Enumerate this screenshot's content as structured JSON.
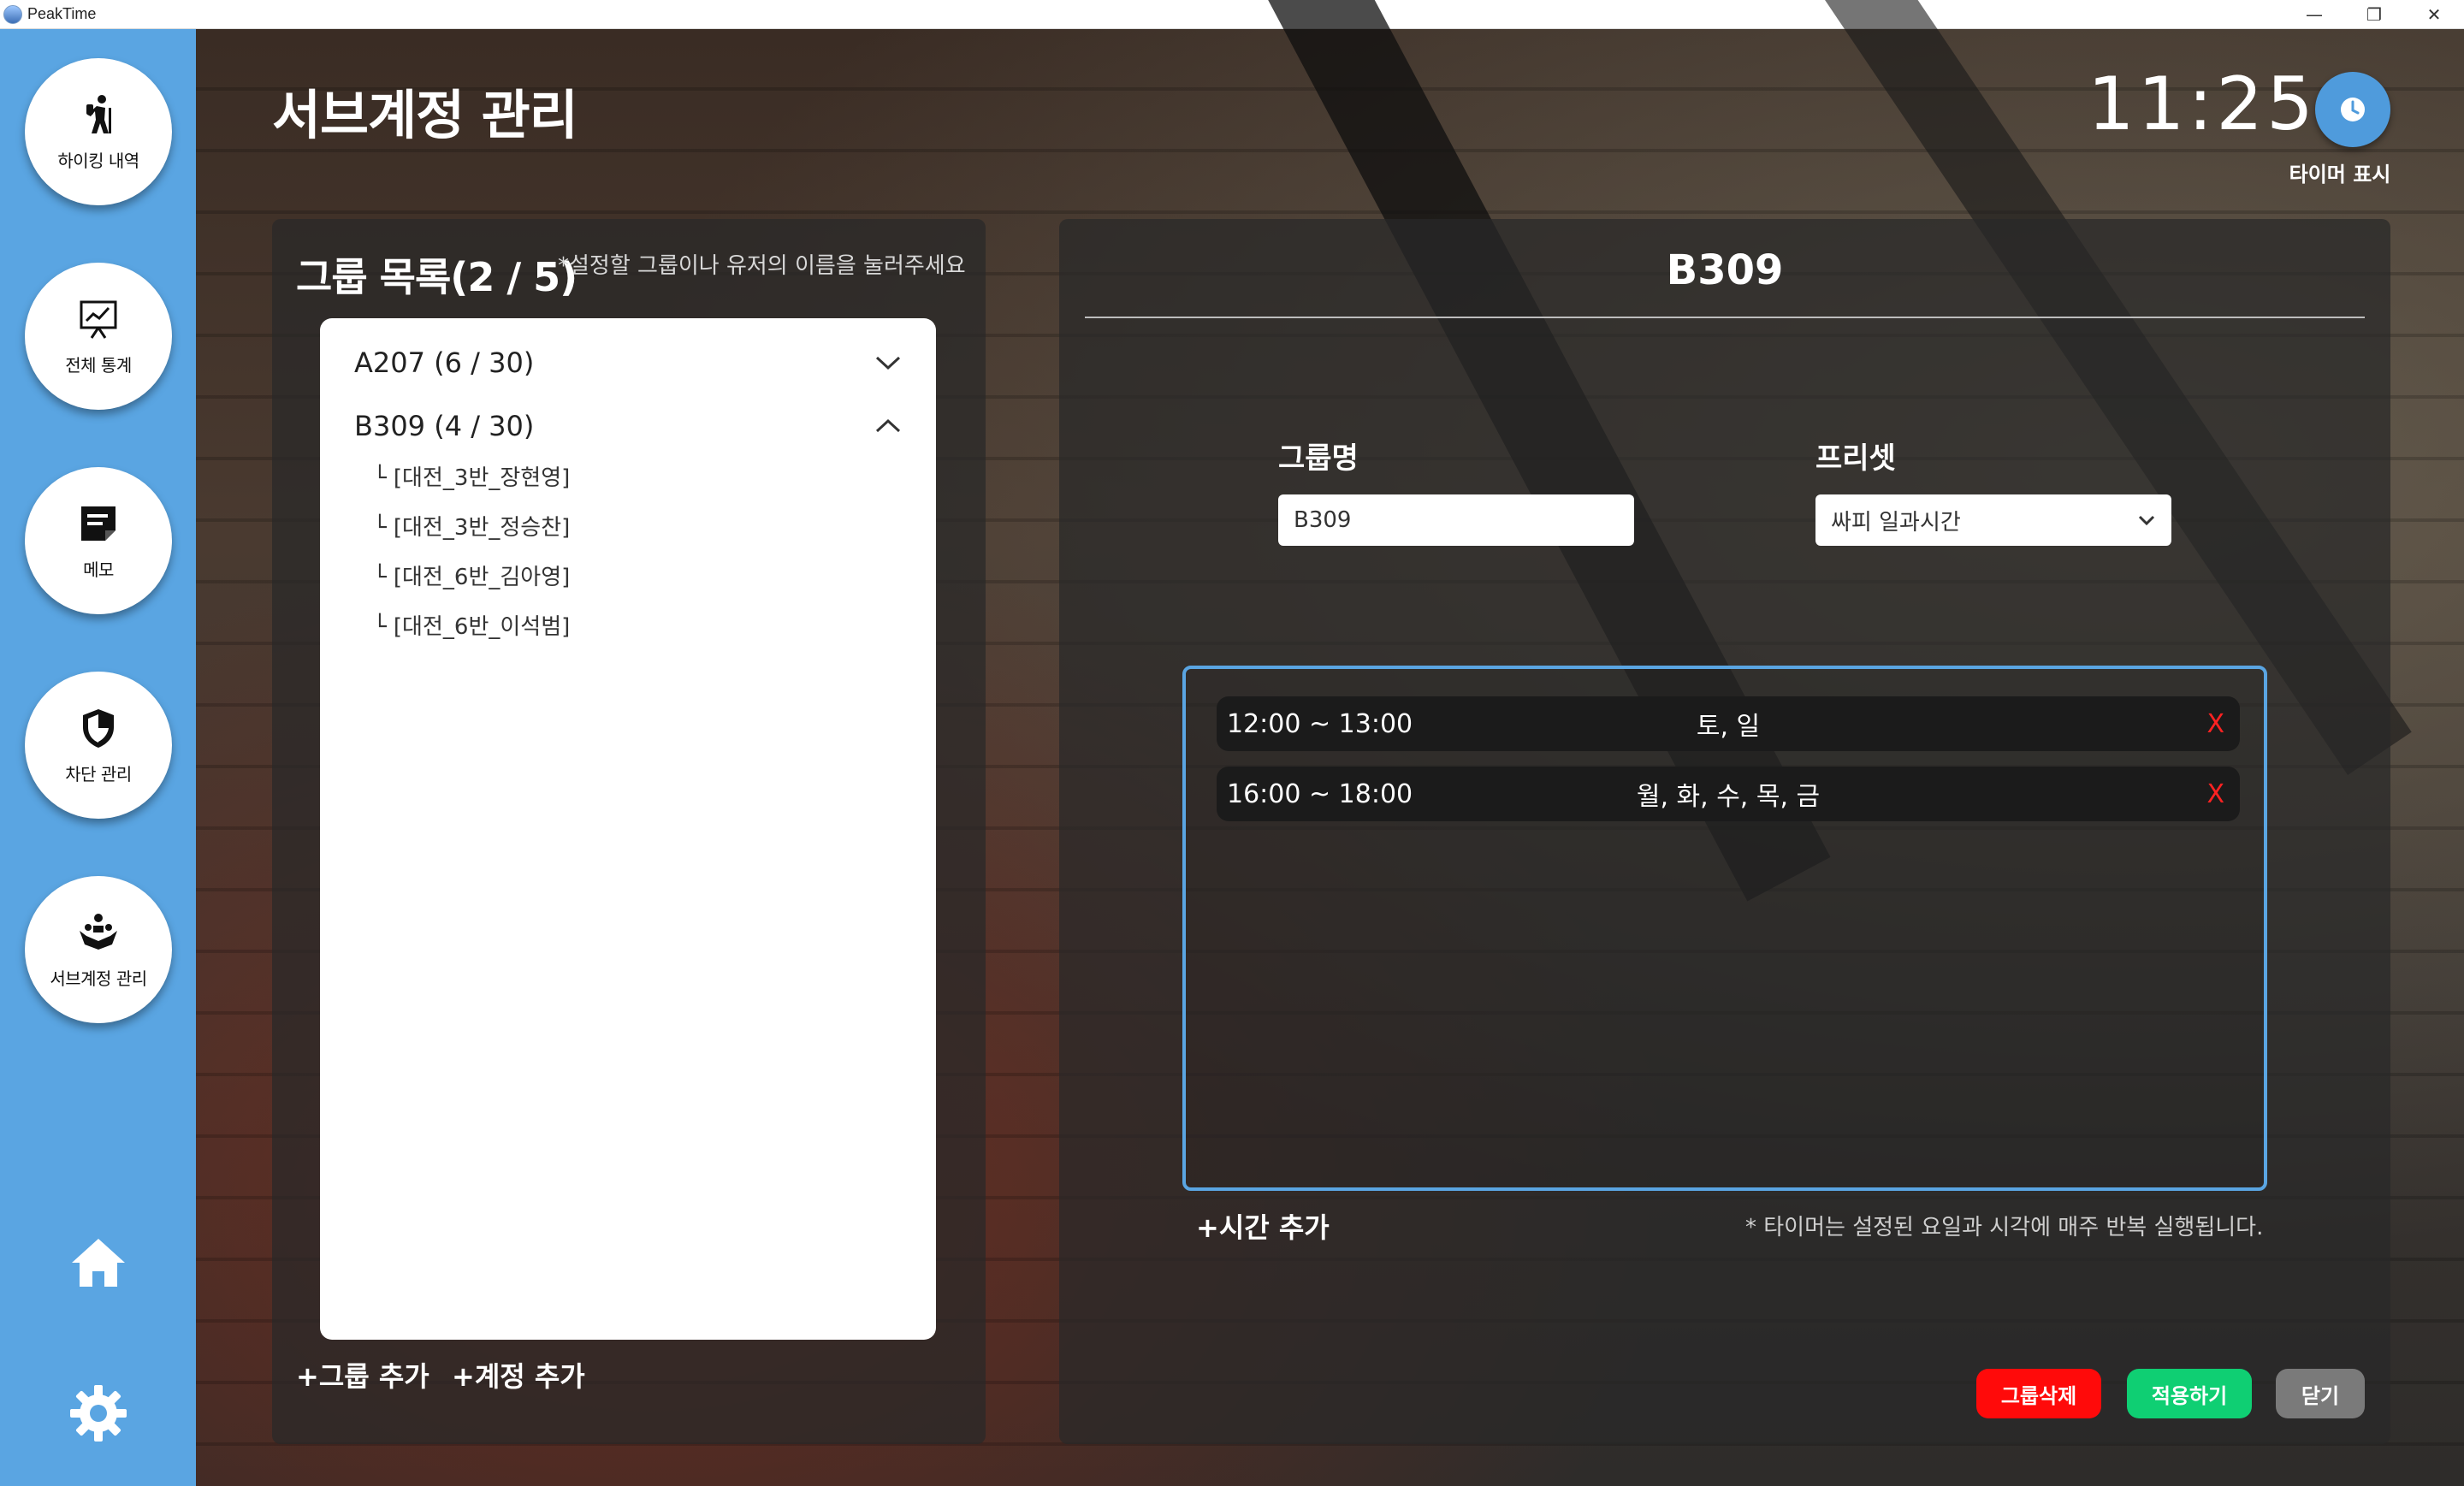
{
  "window": {
    "app_title": "PeakTime",
    "minimize": "—",
    "restore": "❐",
    "close": "✕"
  },
  "sidebar": {
    "items": [
      {
        "label": "하이킹 내역",
        "icon": "hiking-icon"
      },
      {
        "label": "전체 통계",
        "icon": "statistics-icon"
      },
      {
        "label": "메모",
        "icon": "memo-icon"
      },
      {
        "label": "차단 관리",
        "icon": "shield-icon"
      },
      {
        "label": "서브계정 관리",
        "icon": "sub-account-icon"
      }
    ],
    "bottom_icons": [
      "home-icon",
      "gear-icon"
    ]
  },
  "header": {
    "title": "서브계정 관리",
    "clock": "11:25",
    "timer_label": "타이머 표시"
  },
  "group_list": {
    "heading": "그룹 목록(2 / 5)",
    "hint": "*설정할 그룹이나 유저의 이름을 눌러주세요",
    "groups": [
      {
        "name": "A207 (6 / 30)",
        "expanded": false
      },
      {
        "name": "B309 (4 / 30)",
        "expanded": true
      }
    ],
    "members": [
      "└ [대전_3반_장현영]",
      "└ [대전_3반_정승찬]",
      "└ [대전_6반_김아영]",
      "└ [대전_6반_이석범]"
    ],
    "add_group": "+그룹 추가",
    "add_account": "+계정 추가"
  },
  "detail": {
    "title": "B309",
    "group_name_label": "그룹명",
    "group_name_value": "B309",
    "preset_label": "프리셋",
    "preset_value": "싸피 일과시간",
    "schedules": [
      {
        "time": "12:00 ~ 13:00",
        "days": "토, 일",
        "delete": "X"
      },
      {
        "time": "16:00 ~ 18:00",
        "days": "월, 화, 수, 목, 금",
        "delete": "X"
      }
    ],
    "add_time": "+시간 추가",
    "repeat_note": "* 타이머는 설정된 요일과 시각에 매주 반복 실행됩니다.",
    "buttons": {
      "delete_group": "그룹삭제",
      "apply": "적용하기",
      "close": "닫기"
    }
  },
  "colors": {
    "sidebar": "#5aa5e2",
    "delete": "#ff0a0a",
    "apply": "#0fcf73",
    "close": "#7a7a7a",
    "accent": "#4f9bdc"
  }
}
